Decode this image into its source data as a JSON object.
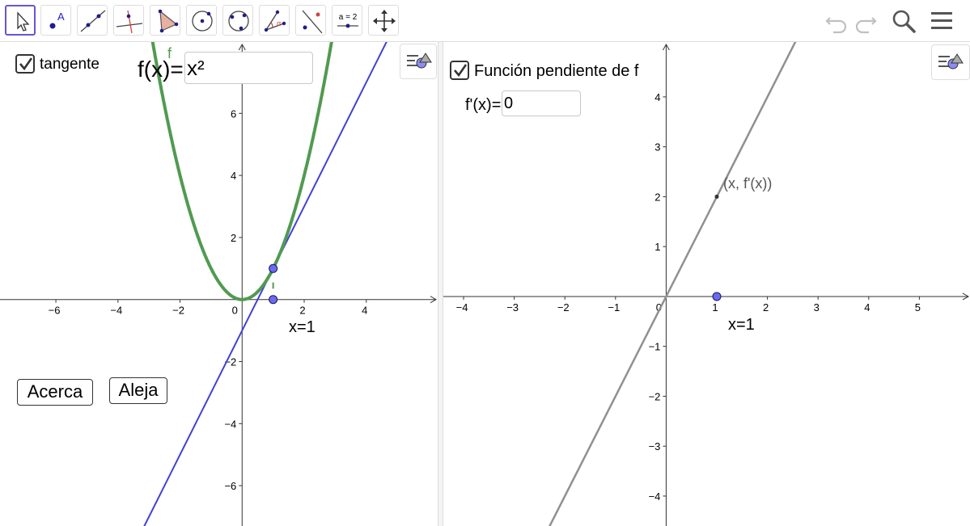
{
  "toolbar": {
    "tools": [
      {
        "name": "move-tool",
        "selected": true
      },
      {
        "name": "point-tool",
        "label": "A"
      },
      {
        "name": "line-tool"
      },
      {
        "name": "perpendicular-line-tool"
      },
      {
        "name": "polygon-tool"
      },
      {
        "name": "circle-center-tool"
      },
      {
        "name": "circle-three-points-tool"
      },
      {
        "name": "angle-tool",
        "label": "α"
      },
      {
        "name": "reflect-tool"
      },
      {
        "name": "slider-tool",
        "label": "a = 2"
      },
      {
        "name": "move-graphics-view-tool"
      }
    ]
  },
  "left_view": {
    "checkbox_label": "tangente",
    "function_label": "f(x)=",
    "function_value": "x²",
    "curve_label": "f",
    "point_label": "x=1",
    "zoom_in_label": "Acerca",
    "zoom_out_label": "Aleja",
    "x_ticks": [
      "−6",
      "−4",
      "−2",
      "0",
      "2",
      "4"
    ],
    "y_ticks": [
      "6",
      "4",
      "2",
      "−2",
      "−4",
      "−6"
    ],
    "colors": {
      "curve": "#519a51",
      "tangent": "#4040dd",
      "point": "#6a6af2"
    }
  },
  "right_view": {
    "checkbox_label": "Función pendiente de f",
    "derivative_label": "f'(x)=",
    "derivative_value": "0",
    "point_label": "(x, f'(x))",
    "point_x_label": "x=1",
    "x_ticks": [
      "−4",
      "−3",
      "−2",
      "−1",
      "0",
      "1",
      "2",
      "3",
      "4",
      "5"
    ],
    "y_ticks": [
      "4",
      "3",
      "2",
      "1",
      "−1",
      "−2",
      "−3",
      "−4"
    ],
    "colors": {
      "line": "#909090"
    }
  },
  "chart_data": [
    {
      "type": "line",
      "series": [
        {
          "name": "f",
          "function": "x^2",
          "x_range": [
            -7.8,
            6.3
          ]
        },
        {
          "function": "2x-1",
          "x_range": [
            -7.8,
            6.3
          ]
        }
      ],
      "points": [
        {
          "x": 1,
          "y": 1
        },
        {
          "x": 1,
          "y": 0
        }
      ],
      "xlim": [
        -7.8,
        6.3
      ],
      "ylim": [
        -7.3,
        8.3
      ],
      "grid": false
    },
    {
      "type": "line",
      "series": [
        {
          "function": "2x",
          "x_range": [
            -4.4,
            6
          ]
        }
      ],
      "points": [
        {
          "x": 1,
          "y": 2
        },
        {
          "x": 1,
          "y": 0
        }
      ],
      "xlim": [
        -4.4,
        6
      ],
      "ylim": [
        -4.6,
        5.1
      ],
      "grid": false
    }
  ]
}
